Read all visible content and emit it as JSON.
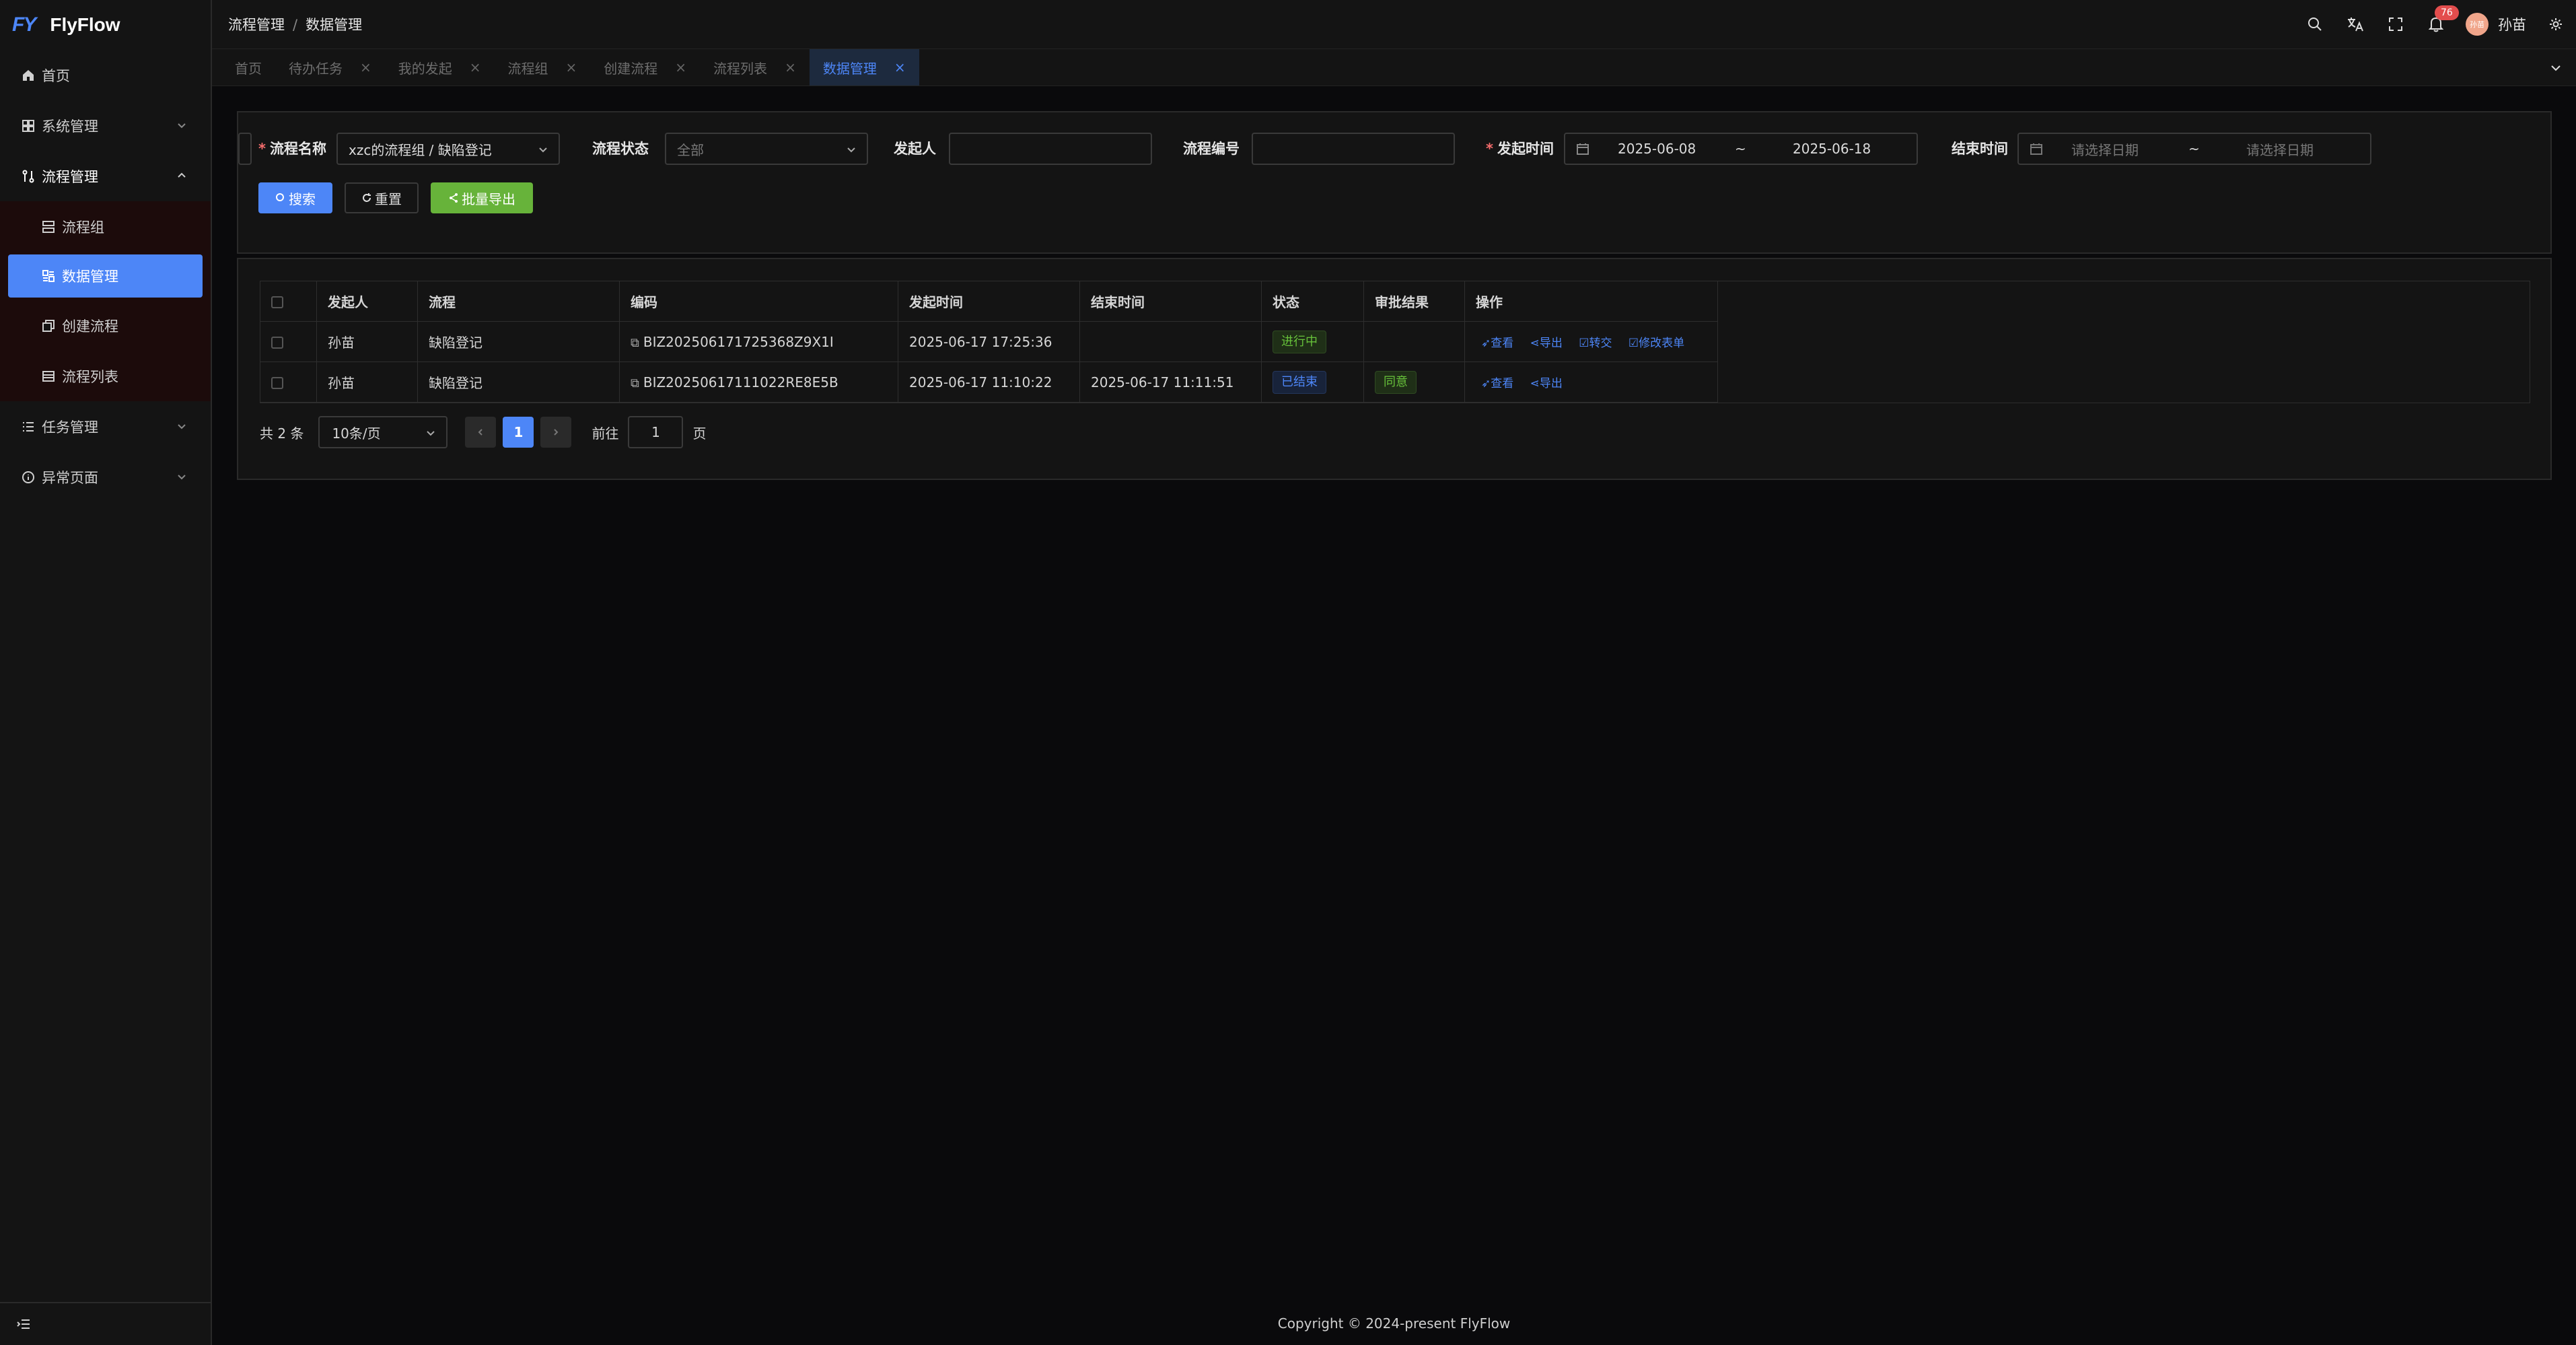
{
  "app": {
    "logo_mark": "FY",
    "name": "FlyFlow"
  },
  "sidebar": {
    "items": [
      {
        "label": "首页",
        "icon": "home-icon"
      },
      {
        "label": "系统管理",
        "icon": "grid-icon"
      },
      {
        "label": "流程管理",
        "icon": "flow-icon"
      },
      {
        "label": "任务管理",
        "icon": "list-icon"
      },
      {
        "label": "异常页面",
        "icon": "info-icon"
      }
    ],
    "sub_items": [
      {
        "label": "流程组"
      },
      {
        "label": "数据管理"
      },
      {
        "label": "创建流程"
      },
      {
        "label": "流程列表"
      }
    ]
  },
  "header": {
    "breadcrumb": [
      "流程管理",
      "数据管理"
    ],
    "notification_count": "76",
    "avatar_text": "孙苗",
    "username": "孙苗"
  },
  "tabs": [
    {
      "label": "首页",
      "closable": false
    },
    {
      "label": "待办任务",
      "closable": true
    },
    {
      "label": "我的发起",
      "closable": true
    },
    {
      "label": "流程组",
      "closable": true
    },
    {
      "label": "创建流程",
      "closable": true
    },
    {
      "label": "流程列表",
      "closable": true
    },
    {
      "label": "数据管理",
      "closable": true,
      "active": true
    }
  ],
  "tab_close_glyph": "×",
  "filter": {
    "process_name_label": "流程名称",
    "process_name_value": "xzc的流程组 / 缺陷登记",
    "status_label": "流程状态",
    "status_value": "全部",
    "initiator_label": "发起人",
    "initiator_value": "",
    "process_no_label": "流程编号",
    "process_no_value": "",
    "start_time_label": "发起时间",
    "start_from": "2025-06-08",
    "start_to": "2025-06-18",
    "end_time_label": "结束时间",
    "end_from_placeholder": "请选择日期",
    "end_to_placeholder": "请选择日期",
    "range_sep": "~",
    "required_mark": "*",
    "search_label": "搜索",
    "reset_label": "重置",
    "export_label": "批量导出"
  },
  "table": {
    "columns": [
      "发起人",
      "流程",
      "编码",
      "发起时间",
      "结束时间",
      "状态",
      "审批结果",
      "操作"
    ],
    "rows": [
      {
        "initiator": "孙苗",
        "process": "缺陷登记",
        "code": "BIZ202506171725368Z9X1I",
        "start_time": "2025-06-17 17:25:36",
        "end_time": "",
        "status": "进行中",
        "result": "",
        "ops": [
          "查看",
          "导出",
          "转交",
          "修改表单"
        ]
      },
      {
        "initiator": "孙苗",
        "process": "缺陷登记",
        "code": "BIZ20250617111022RE8E5B",
        "start_time": "2025-06-17 11:10:22",
        "end_time": "2025-06-17 11:11:51",
        "status": "已结束",
        "result": "同意",
        "ops": [
          "查看",
          "导出"
        ]
      }
    ]
  },
  "pager": {
    "total": "共 2 条",
    "page_size": "10条/页",
    "current_page": "1",
    "goto_label": "前往",
    "goto_value": "1",
    "page_unit": "页"
  },
  "footer": {
    "copyright": "Copyright © 2024-present FlyFlow"
  },
  "colors": {
    "accent": "#4d86f7",
    "success": "#67b33a",
    "danger": "#f56c6c"
  }
}
